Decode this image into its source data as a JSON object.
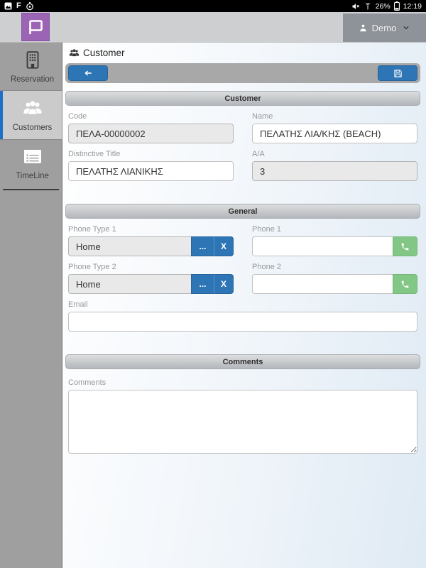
{
  "status_bar": {
    "battery_percent": "26%",
    "time": "12:19"
  },
  "app_header": {
    "user_label": "Demo"
  },
  "sidebar": {
    "items": [
      {
        "label": "Reservation"
      },
      {
        "label": "Customers"
      },
      {
        "label": "TimeLine"
      }
    ]
  },
  "page": {
    "title": "Customer"
  },
  "customer_section": {
    "title": "Customer",
    "code_label": "Code",
    "code_value": "ΠΕΛΑ-00000002",
    "name_label": "Name",
    "name_value": "ΠΕΛΑΤΗΣ ΛΙΑ/ΚΗΣ (BEACH)",
    "distinctive_title_label": "Distinctive Title",
    "distinctive_title_value": "ΠΕΛΑΤΗΣ ΛΙΑΝΙΚΗΣ",
    "aa_label": "Α/Α",
    "aa_value": "3"
  },
  "general_section": {
    "title": "General",
    "phone_type_1_label": "Phone Type 1",
    "phone_type_1_value": "Home",
    "phone_1_label": "Phone 1",
    "phone_1_value": "",
    "phone_type_2_label": "Phone Type 2",
    "phone_type_2_value": "Home",
    "phone_2_label": "Phone 2",
    "phone_2_value": "",
    "email_label": "Email",
    "email_value": "",
    "browse_button_label": "...",
    "clear_button_label": "X"
  },
  "comments_section": {
    "title": "Comments",
    "comments_label": "Comments",
    "comments_value": ""
  },
  "colors": {
    "accent_blue": "#2e75b6",
    "accent_green": "#82c786",
    "logo_purple": "#9c64b5",
    "active_item_accent": "#1f6fc4"
  }
}
